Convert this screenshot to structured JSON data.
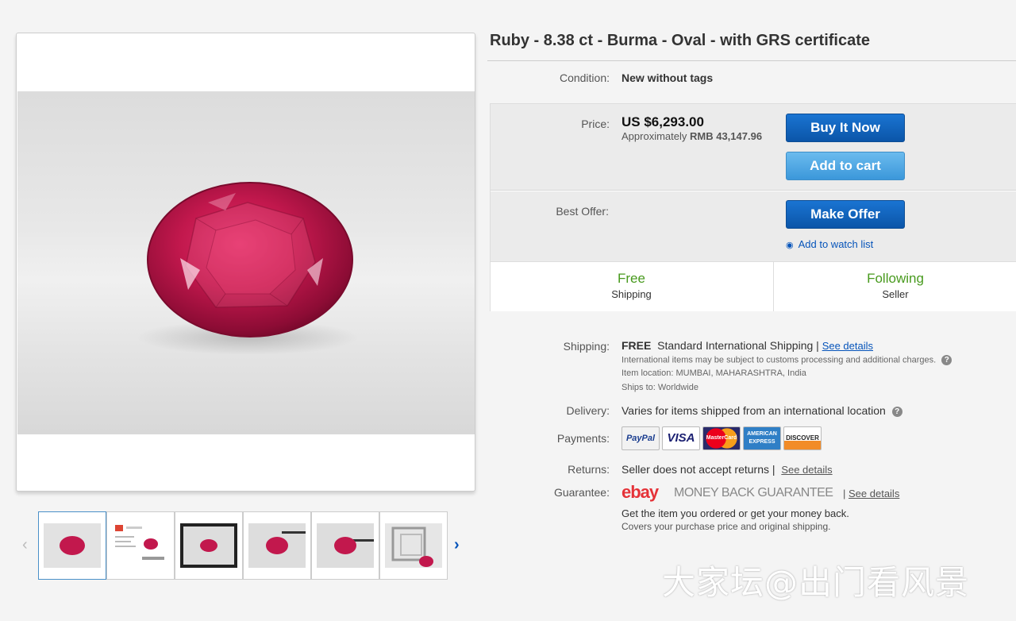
{
  "item": {
    "title": "Ruby - 8.38 ct - Burma - Oval - with GRS certificate",
    "condition_label": "Condition:",
    "condition_value": "New without tags",
    "price_label": "Price:",
    "price_value": "US $6,293.00",
    "approx_prefix": "Approximately",
    "approx_value": "RMB 43,147.96",
    "buy_now": "Buy It Now",
    "add_to_cart": "Add to cart",
    "best_offer_label": "Best Offer:",
    "make_offer": "Make Offer",
    "watch_list": "Add to watch list",
    "free_big": "Free",
    "free_small": "Shipping",
    "following_big": "Following",
    "following_small": "Seller"
  },
  "shipping": {
    "label": "Shipping:",
    "free": "FREE",
    "service": "Standard International Shipping |",
    "see_details": "See details",
    "customs_note": "International items may be subject to customs processing and additional charges.",
    "location": "Item location:  MUMBAI, MAHARASHTRA, India",
    "ships_to": "Ships to:  Worldwide"
  },
  "delivery": {
    "label": "Delivery:",
    "value": "Varies for items shipped from an international location"
  },
  "payments": {
    "label": "Payments:",
    "logos": [
      "PayPal",
      "VISA",
      "MasterCard",
      "AMERICAN EXPRESS",
      "DISCOVER"
    ]
  },
  "returns": {
    "label": "Returns:",
    "value": "Seller does not accept returns |",
    "see_details": "See details"
  },
  "guarantee": {
    "label": "Guarantee:",
    "brand": "ebay",
    "program": "MONEY BACK GUARANTEE",
    "see_details": "See details",
    "line1": "Get the item you ordered or get your money back.",
    "line2": "Covers your purchase price and original shipping."
  },
  "watermark": "大家坛@出门看风景",
  "colors": {
    "link": "#0654ba",
    "green": "#489a1e",
    "ruby": "#c2184d",
    "button_dark": "#0b55a8",
    "button_light": "#3b97da"
  }
}
